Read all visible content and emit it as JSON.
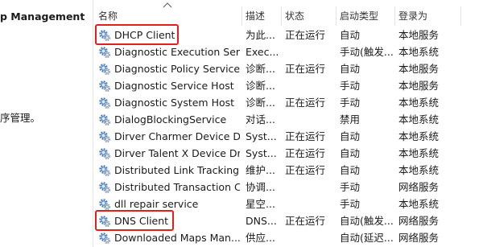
{
  "left_pane": {
    "title": "p Management",
    "description": "序管理。"
  },
  "columns": {
    "name": "名称",
    "description": "描述",
    "status": "状态",
    "startup_type": "启动类型",
    "log_on_as": "登录为"
  },
  "services": [
    {
      "name": "DHCP Client",
      "description": "为此...",
      "status": "正在运行",
      "startup_type": "自动",
      "log_on_as": "本地服务",
      "highlighted": true
    },
    {
      "name": "Diagnostic Execution Ser...",
      "description": "Exec...",
      "status": "",
      "startup_type": "手动(触发...",
      "log_on_as": "本地系统"
    },
    {
      "name": "Diagnostic Policy Service",
      "description": "诊断...",
      "status": "正在运行",
      "startup_type": "自动",
      "log_on_as": "本地服务"
    },
    {
      "name": "Diagnostic Service Host",
      "description": "诊断...",
      "status": "",
      "startup_type": "手动",
      "log_on_as": "本地服务"
    },
    {
      "name": "Diagnostic System Host",
      "description": "诊断...",
      "status": "正在运行",
      "startup_type": "手动",
      "log_on_as": "本地系统"
    },
    {
      "name": "DialogBlockingService",
      "description": "对话...",
      "status": "",
      "startup_type": "禁用",
      "log_on_as": "本地系统"
    },
    {
      "name": "Dirver Charmer Device D...",
      "description": "Syst...",
      "status": "正在运行",
      "startup_type": "自动",
      "log_on_as": "本地系统"
    },
    {
      "name": "Dirver Talent X Device Dr...",
      "description": "Syst...",
      "status": "正在运行",
      "startup_type": "自动",
      "log_on_as": "本地系统"
    },
    {
      "name": "Distributed Link Tracking...",
      "description": "维护...",
      "status": "正在运行",
      "startup_type": "自动",
      "log_on_as": "本地系统"
    },
    {
      "name": "Distributed Transaction C...",
      "description": "协调...",
      "status": "",
      "startup_type": "手动",
      "log_on_as": "网络服务"
    },
    {
      "name": "dll repair service",
      "description": "星空...",
      "status": "",
      "startup_type": "手动",
      "log_on_as": "本地系统"
    },
    {
      "name": "DNS Client",
      "description": "DNS...",
      "status": "正在运行",
      "startup_type": "自动(触发...",
      "log_on_as": "网络服务",
      "highlighted": true
    },
    {
      "name": "Downloaded Maps Man...",
      "description": "供应...",
      "status": "",
      "startup_type": "自动(延迟...",
      "log_on_as": "网络服务"
    }
  ],
  "colors": {
    "highlight": "#e0201c",
    "gear_blue": "#4a7fc0",
    "gear_gray": "#8a9aab"
  },
  "icons": {
    "service": "gear-icon",
    "sort": "sort-ascending-icon"
  }
}
